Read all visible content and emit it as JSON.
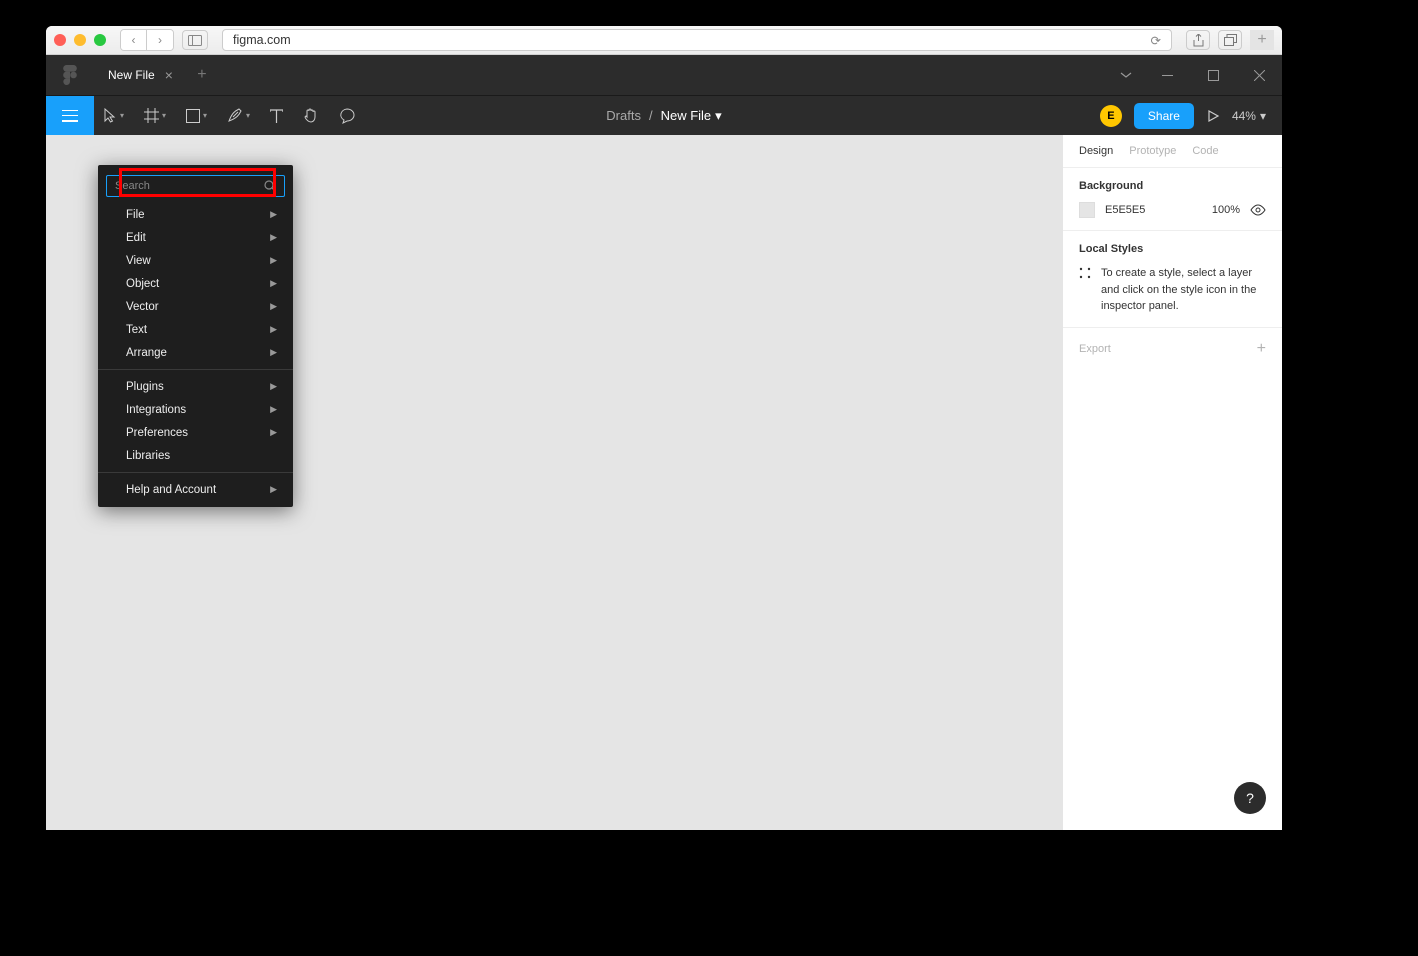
{
  "browser": {
    "url": "figma.com"
  },
  "tab": {
    "title": "New File"
  },
  "breadcrumb": {
    "parent": "Drafts",
    "current": "New File"
  },
  "toolbar": {
    "avatar_initial": "E",
    "share": "Share",
    "zoom": "44%"
  },
  "menu": {
    "search_placeholder": "Search",
    "groups": [
      [
        "File",
        "Edit",
        "View",
        "Object",
        "Vector",
        "Text",
        "Arrange"
      ],
      [
        "Plugins",
        "Integrations",
        "Preferences",
        "Libraries"
      ],
      [
        "Help and Account"
      ]
    ],
    "no_arrow": [
      "Libraries"
    ]
  },
  "right_panel": {
    "tabs": [
      "Design",
      "Prototype",
      "Code"
    ],
    "active_tab": "Design",
    "background": {
      "title": "Background",
      "hex": "E5E5E5",
      "opacity": "100%"
    },
    "local_styles": {
      "title": "Local Styles",
      "hint": "To create a style, select a layer and click on the style icon in the inspector panel."
    },
    "export": "Export"
  },
  "help_label": "?"
}
